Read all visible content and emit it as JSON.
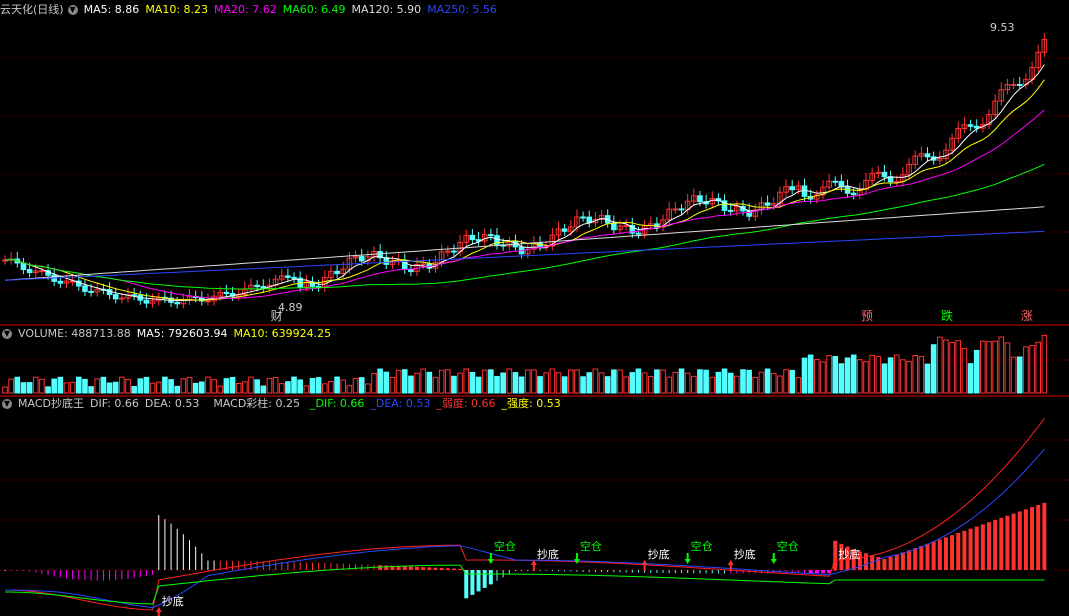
{
  "main_panel": {
    "stock_name": "云天化(日线)",
    "ma": [
      {
        "label": "MA5: 8.86",
        "color": "#ffffff"
      },
      {
        "label": "MA10: 8.23",
        "color": "#ffff00"
      },
      {
        "label": "MA20: 7.62",
        "color": "#ff00ff"
      },
      {
        "label": "MA60: 6.49",
        "color": "#00ff00"
      },
      {
        "label": "MA120: 5.90",
        "color": "#dcdcdc"
      },
      {
        "label": "MA250: 5.56",
        "color": "#2b46ff"
      }
    ],
    "high_price": "9.53",
    "low_price": "4.89",
    "markers": [
      {
        "text": "财",
        "color": "#d0d0d0",
        "i": 44
      },
      {
        "text": "预",
        "color": "#ff6464",
        "i": 140
      },
      {
        "text": "跌",
        "color": "#00ff00",
        "i": 153
      },
      {
        "text": "涨",
        "color": "#ff6464",
        "i": 166
      }
    ]
  },
  "volume_panel": {
    "title": "VOLUME: 488713.88",
    "ma5": "MA5: 792603.94",
    "ma10": "MA10: 639924.25"
  },
  "macd_panel": {
    "name": "MACD抄底王",
    "dif": "DIF: 0.66",
    "dea": "DEA: 0.53",
    "bar": "MACD彩柱: 0.25",
    "dif2": "_DIF: 0.66",
    "dea2": "_DEA: 0.53",
    "weak": "_弱度: 0.66",
    "strong": "_强度: 0.53",
    "signals": [
      {
        "text": "抄底",
        "type": "buy",
        "i": 25
      },
      {
        "text": "空仓",
        "type": "sell",
        "i": 79
      },
      {
        "text": "抄底",
        "type": "buy",
        "i": 86
      },
      {
        "text": "空仓",
        "type": "sell",
        "i": 93
      },
      {
        "text": "抄底",
        "type": "buy",
        "i": 104
      },
      {
        "text": "空仓",
        "type": "sell",
        "i": 111
      },
      {
        "text": "抄底",
        "type": "buy",
        "i": 118
      },
      {
        "text": "空仓",
        "type": "sell",
        "i": 125
      },
      {
        "text": "抄底",
        "type": "buy",
        "i": 135
      }
    ]
  },
  "colors": {
    "up": "#ff3232",
    "down": "#54ffff",
    "grid": "#7a0000",
    "panel_border": "#b00000",
    "dif": "#ff2020",
    "dea": "#2b46ff",
    "macd_line": "#00ff00",
    "macd_neg": "#ff00ff"
  }
}
